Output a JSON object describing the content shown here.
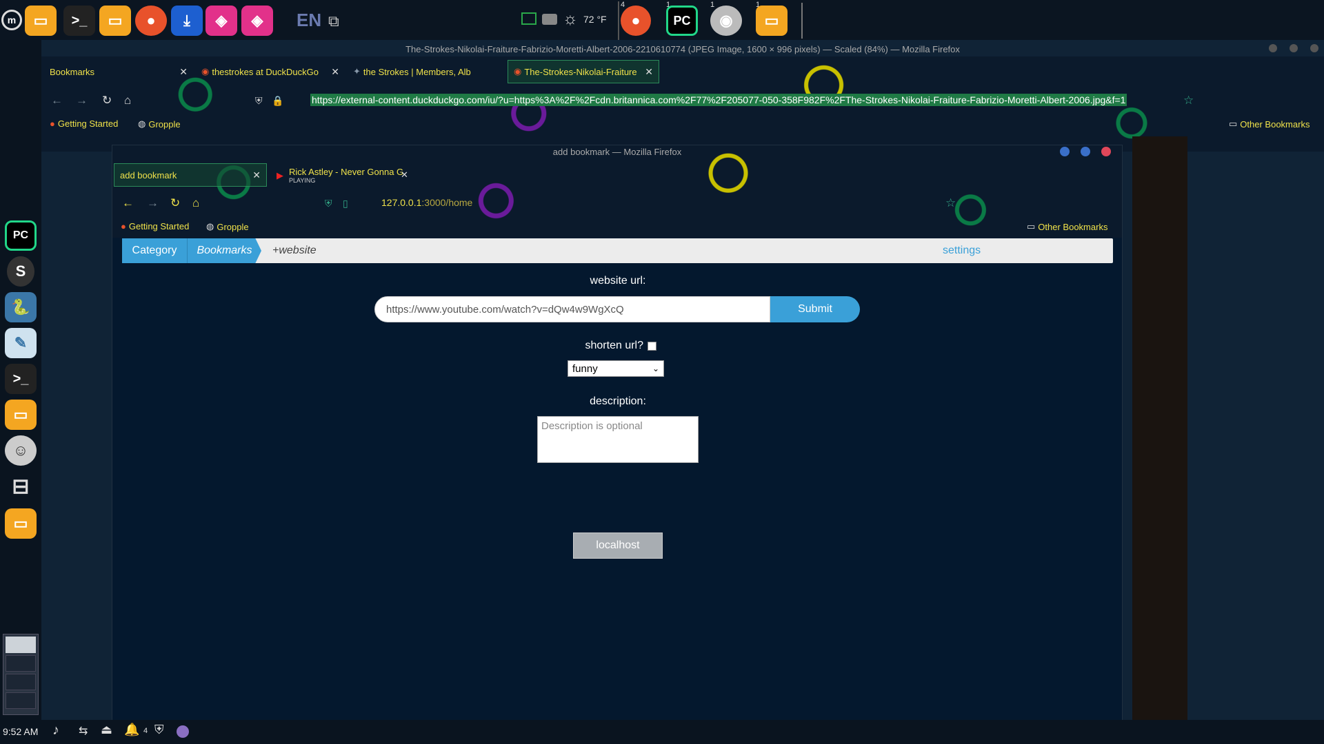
{
  "taskbar": {
    "lang": "EN",
    "weather": "72 °F",
    "badges": {
      "firefox": "4",
      "pycharm": "1",
      "eye": "1",
      "files": "1"
    },
    "pycharm_label": "PC"
  },
  "dock": {
    "pycharm_label": "PC",
    "s_label": "S"
  },
  "bottom": {
    "time": "9:52 AM",
    "notif_count": "4"
  },
  "outer": {
    "title": "The-Strokes-Nikolai-Fraiture-Fabrizio-Moretti-Albert-2006-2210610774 (JPEG Image, 1600 × 996 pixels) — Scaled (84%) — Mozilla Firefox",
    "tabs": [
      {
        "label": "Bookmarks"
      },
      {
        "label": "thestrokes at DuckDuckGo"
      },
      {
        "label": "the Strokes | Members, Alb"
      },
      {
        "label": "The-Strokes-Nikolai-Fraiture"
      }
    ],
    "url": "https://external-content.duckduckgo.com/iu/?u=https%3A%2F%2Fcdn.britannica.com%2F77%2F205077-050-358F982F%2FThe-Strokes-Nikolai-Fraiture-Fabrizio-Moretti-Albert-2006.jpg&f=1",
    "bookmarks": {
      "getting_started": "Getting Started",
      "gropple": "Gropple",
      "other": "Other Bookmarks"
    }
  },
  "inner": {
    "title": "add bookmark — Mozilla Firefox",
    "tabs": [
      {
        "label": "add bookmark"
      },
      {
        "label": "Rick Astley - Never Gonna G",
        "sub": "PLAYING"
      }
    ],
    "url_host": "127.0.0.1",
    "url_rest": ":3000/home",
    "bookmarks": {
      "getting_started": "Getting Started",
      "gropple": "Gropple",
      "other": "Other Bookmarks"
    }
  },
  "page": {
    "crumbs": {
      "category": "Category",
      "bookmarks": "Bookmarks",
      "website": "+website",
      "settings": "settings"
    },
    "website_url_label": "website url:",
    "website_url_value": "https://www.youtube.com/watch?v=dQw4w9WgXcQ",
    "submit": "Submit",
    "shorten_label": "shorten url?",
    "category_selected": "funny",
    "description_label": "description:",
    "description_placeholder": "Description is optional",
    "localhost_button": "localhost"
  },
  "colors": {
    "accent": "#3aa0d8",
    "festive_yellow": "#f0e24a",
    "page_bg": "#04182e"
  }
}
